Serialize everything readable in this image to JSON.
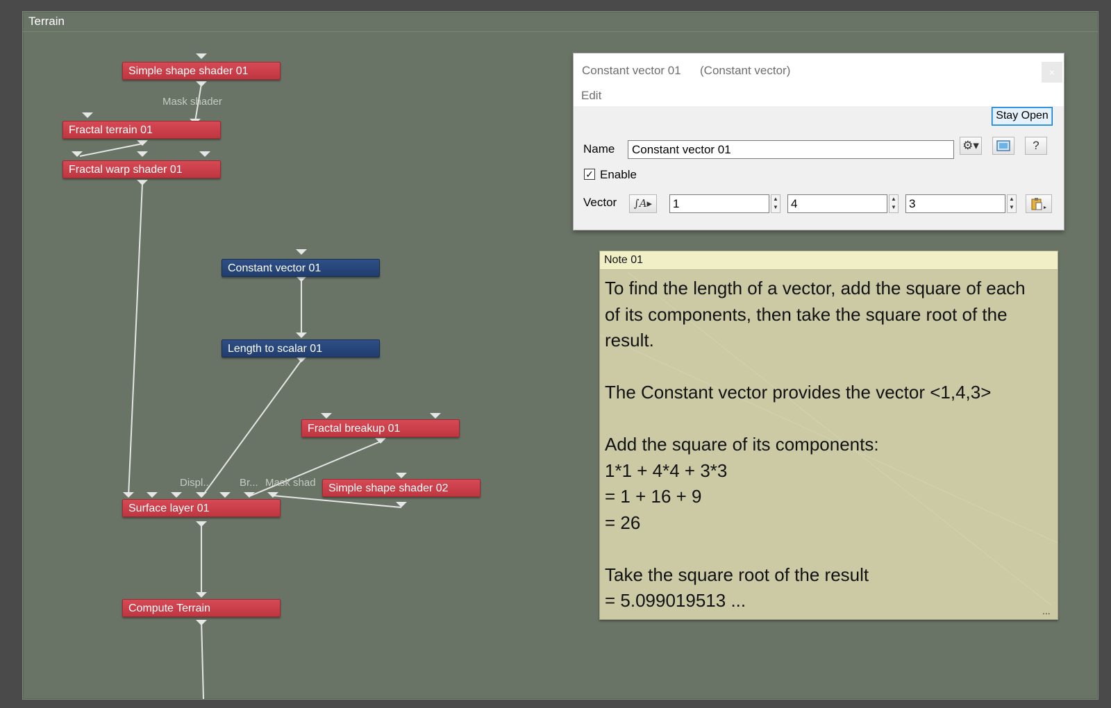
{
  "canvas": {
    "title": "Terrain"
  },
  "nodes": {
    "simple_shape_shader_01": "Simple shape shader 01",
    "fractal_terrain_01": "Fractal terrain 01",
    "fractal_warp_shader_01": "Fractal warp shader 01",
    "constant_vector_01": "Constant vector 01",
    "length_to_scalar_01": "Length to scalar 01",
    "fractal_breakup_01": "Fractal breakup 01",
    "simple_shape_shader_02": "Simple shape shader 02",
    "surface_layer_01": "Surface layer 01",
    "compute_terrain": "Compute Terrain"
  },
  "port_labels": {
    "mask_shader": "Mask shader",
    "displ": "Displ...",
    "br": "Br...",
    "mask_shad": "Mask shad"
  },
  "dialog": {
    "title": "Constant vector 01",
    "subtitle": "(Constant vector)",
    "close": "×",
    "menu_edit": "Edit",
    "stay_open": "Stay Open",
    "name_label": "Name",
    "name_value": "Constant vector 01",
    "enable_label": "Enable",
    "enable_checked": true,
    "vector_label": "Vector",
    "vector_x": "1",
    "vector_y": "4",
    "vector_z": "3",
    "icons": [
      "gear-icon",
      "preview-icon",
      "help-icon",
      "function-icon",
      "paste-icon"
    ],
    "help_glyph": "?"
  },
  "note": {
    "title": "Note 01",
    "lines": [
      "To find the length of a vector, add the square of each",
      "of its components, then take the square root of the",
      "result.",
      "",
      "The Constant vector provides the vector <1,4,3>",
      "",
      "Add the square of its components:",
      "1*1 + 4*4 + 3*3",
      "= 1 + 16 + 9",
      "= 26",
      "",
      "Take the square root of the result",
      "= 5.099019513 ..."
    ],
    "more": "..."
  },
  "colors": {
    "canvas_bg": "#6a7466",
    "node_red": "#c93d48",
    "node_blue": "#26457a",
    "wire": "#e6e6e6",
    "note_bg": "#cbcaa5",
    "note_title_bg": "#f0efc5"
  }
}
